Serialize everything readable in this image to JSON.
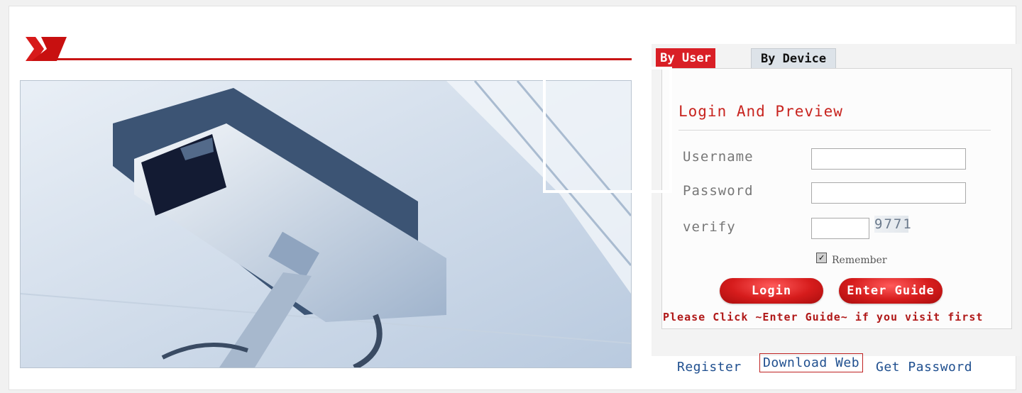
{
  "tabs": [
    {
      "label": "By User",
      "active": true
    },
    {
      "label": "By Device",
      "active": false
    }
  ],
  "login": {
    "title": "Login And Preview",
    "username_label": "Username",
    "password_label": "Password",
    "verify_label": "verify",
    "username_value": "",
    "password_value": "",
    "verify_value": "",
    "captcha": "9771",
    "remember_label": "Remember",
    "remember_checked": true,
    "login_button": "Login",
    "guide_button": "Enter Guide",
    "notice": "Please Click ~Enter Guide~ if you visit first"
  },
  "footer_links": {
    "register": "Register",
    "download": "Download Web",
    "get_password": "Get Password"
  },
  "colors": {
    "accent_red": "#d91f26",
    "link_blue": "#1f4f8f"
  }
}
